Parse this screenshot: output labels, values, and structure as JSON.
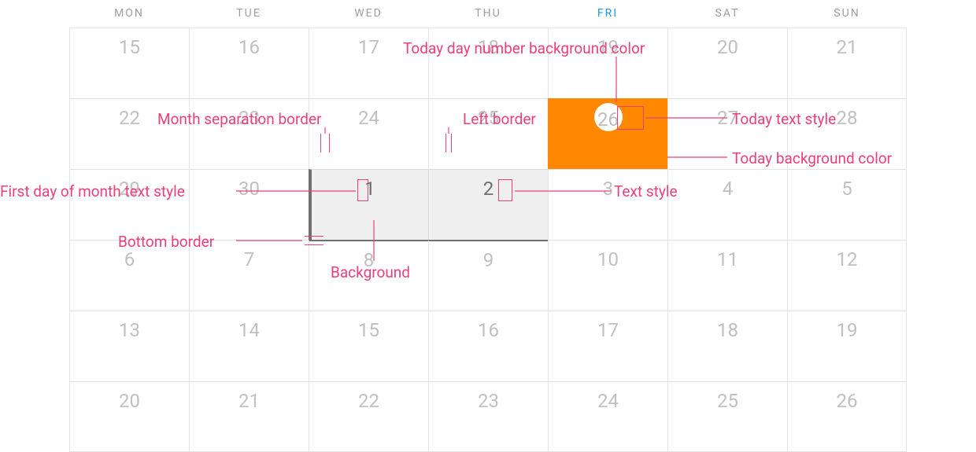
{
  "header": {
    "days": [
      "MON",
      "TUE",
      "WED",
      "THU",
      "FRI",
      "SAT",
      "SUN"
    ],
    "highlight_index": 4
  },
  "weeks": [
    [
      {
        "n": 15
      },
      {
        "n": 16
      },
      {
        "n": 17
      },
      {
        "n": 18
      },
      {
        "n": 19
      },
      {
        "n": 20
      },
      {
        "n": 21
      }
    ],
    [
      {
        "n": 22
      },
      {
        "n": 23
      },
      {
        "n": 24
      },
      {
        "n": 25
      },
      {
        "n": 26,
        "today": true
      },
      {
        "n": 27
      },
      {
        "n": 28
      }
    ],
    [
      {
        "n": 29
      },
      {
        "n": 30
      },
      {
        "n": 1,
        "next": true,
        "first": true
      },
      {
        "n": 2,
        "next": true
      },
      {
        "n": 3
      },
      {
        "n": 4
      },
      {
        "n": 5
      }
    ],
    [
      {
        "n": 6
      },
      {
        "n": 7
      },
      {
        "n": 8
      },
      {
        "n": 9
      },
      {
        "n": 10
      },
      {
        "n": 11
      },
      {
        "n": 12
      }
    ],
    [
      {
        "n": 13
      },
      {
        "n": 14
      },
      {
        "n": 15
      },
      {
        "n": 16
      },
      {
        "n": 17
      },
      {
        "n": 18
      },
      {
        "n": 19
      }
    ],
    [
      {
        "n": 20
      },
      {
        "n": 21
      },
      {
        "n": 22
      },
      {
        "n": 23
      },
      {
        "n": 24
      },
      {
        "n": 25
      },
      {
        "n": 26
      }
    ]
  ],
  "annotations": {
    "today_num_bg": "Today day number background color",
    "month_sep": "Month separation border",
    "left_border": "Left border",
    "today_text": "Today text style",
    "today_bg": "Today background color",
    "first_day": "First day of month text style",
    "bottom_border": "Bottom border",
    "background": "Background",
    "text_style": "Text style"
  },
  "colors": {
    "accent": "#FF8800",
    "annotation": "#ec407a",
    "friday_header": "#2196f3",
    "month_separator": "#707070"
  }
}
